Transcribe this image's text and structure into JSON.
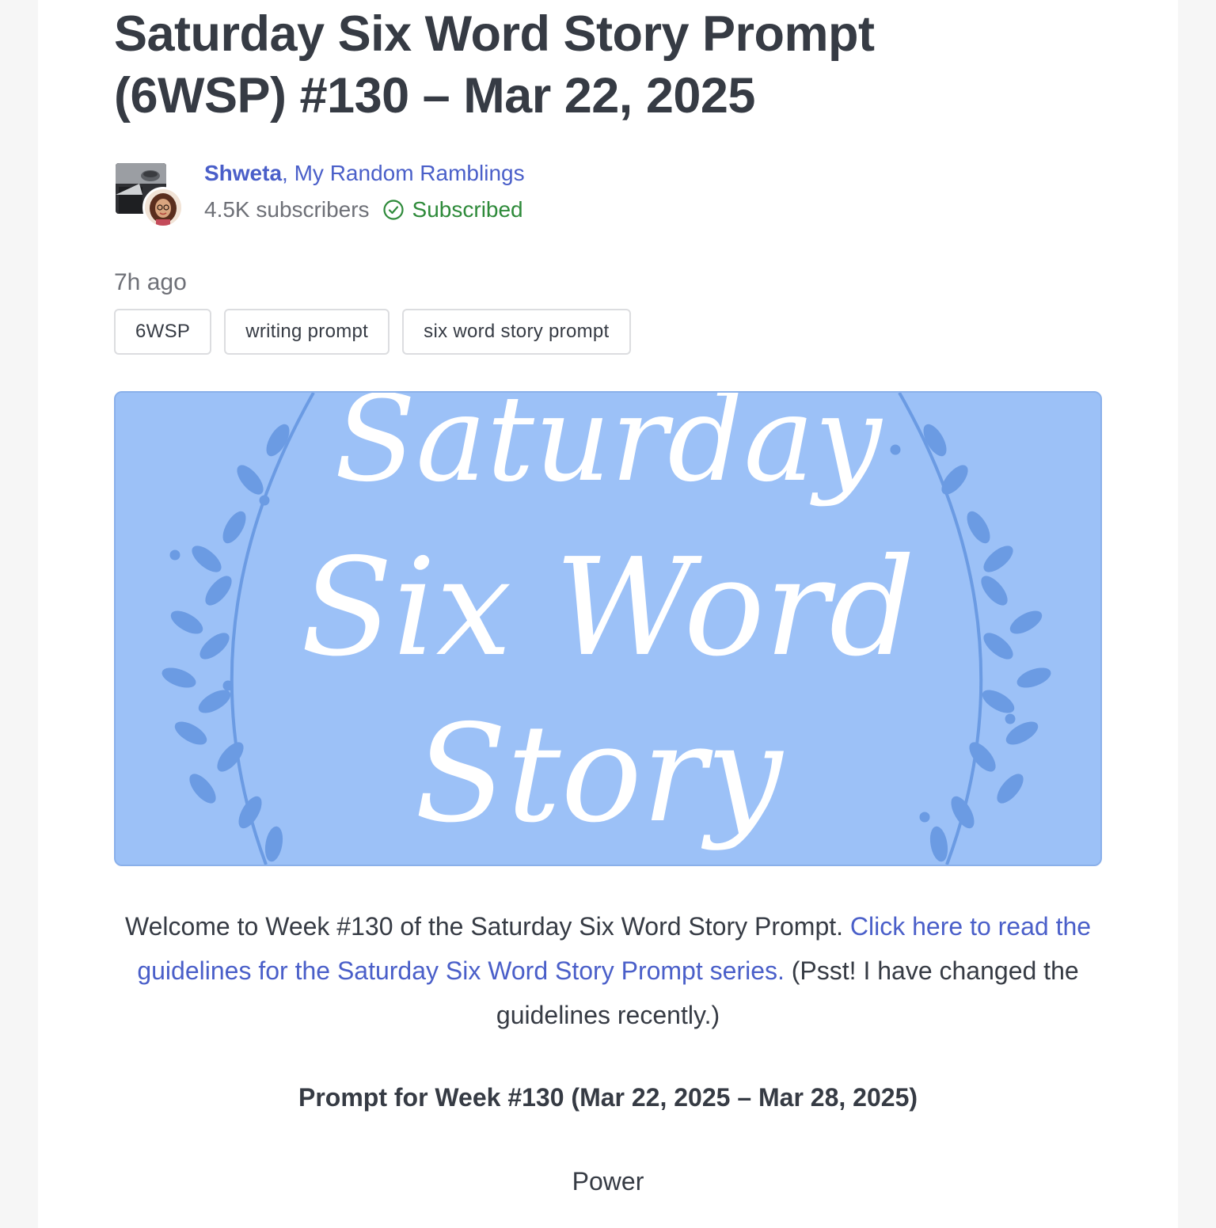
{
  "post": {
    "title": "Saturday Six Word Story Prompt (6WSP) #130 – Mar 22, 2025",
    "time_ago": "7h ago"
  },
  "author": {
    "name": "Shweta",
    "separator": ", ",
    "publication": "My Random Ramblings",
    "subscribers": "4.5K subscribers",
    "subscribed_label": "Subscribed",
    "subscribed_icon": "check-circle-icon"
  },
  "tags": [
    "6WSP",
    "writing prompt",
    "six word story prompt"
  ],
  "hero": {
    "line1": "Saturday",
    "line2": "Six Word",
    "line3": "Story",
    "bg_color": "#9cc1f7",
    "leaf_color": "#6b9be3"
  },
  "body": {
    "intro": "Welcome to Week #130 of the Saturday Six Word Story Prompt. ",
    "link": "Click here to read the guidelines for the Saturday Six Word Story Prompt series.",
    "note": " (Psst! I have changed the guidelines recently.)",
    "prompt_heading": "Prompt for Week #130 (Mar 22, 2025 – Mar 28, 2025)",
    "prompt_word": "Power"
  },
  "colors": {
    "link": "#4a5fc9",
    "subscribed": "#2e8a3a",
    "text": "#363b44"
  }
}
